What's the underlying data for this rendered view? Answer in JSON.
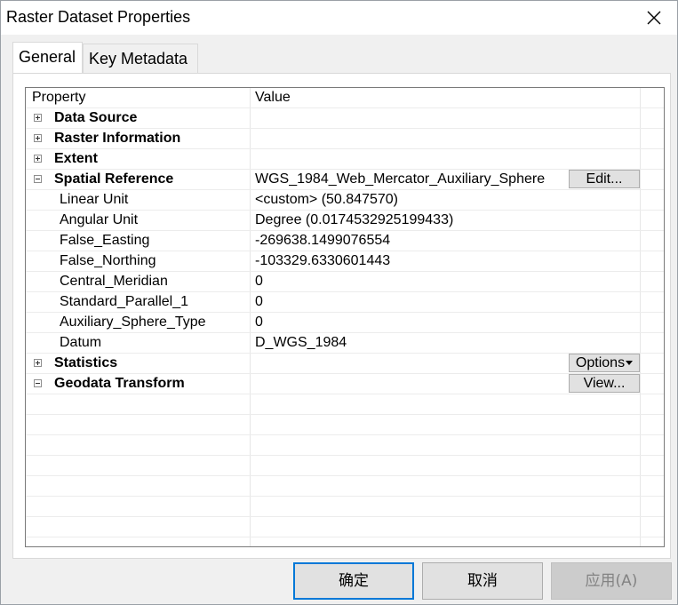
{
  "window": {
    "title": "Raster Dataset Properties"
  },
  "tabs": [
    {
      "label": "General",
      "active": true
    },
    {
      "label": "Key Metadata",
      "active": false
    }
  ],
  "grid": {
    "header": {
      "property": "Property",
      "value": "Value"
    },
    "rows": [
      {
        "kind": "group",
        "expanded": false,
        "property": "Data Source",
        "value": ""
      },
      {
        "kind": "group",
        "expanded": false,
        "property": "Raster Information",
        "value": ""
      },
      {
        "kind": "group",
        "expanded": false,
        "property": "Extent",
        "value": ""
      },
      {
        "kind": "group",
        "expanded": true,
        "property": "Spatial Reference",
        "value": "WGS_1984_Web_Mercator_Auxiliary_Sphere",
        "button": "Edit..."
      },
      {
        "kind": "child",
        "property": "Linear Unit",
        "value": "<custom> (50.847570)"
      },
      {
        "kind": "child",
        "property": "Angular Unit",
        "value": "Degree (0.0174532925199433)"
      },
      {
        "kind": "child",
        "property": "False_Easting",
        "value": "-269638.1499076554"
      },
      {
        "kind": "child",
        "property": "False_Northing",
        "value": "-103329.6330601443"
      },
      {
        "kind": "child",
        "property": "Central_Meridian",
        "value": "0"
      },
      {
        "kind": "child",
        "property": "Standard_Parallel_1",
        "value": "0"
      },
      {
        "kind": "child",
        "property": "Auxiliary_Sphere_Type",
        "value": "0"
      },
      {
        "kind": "child",
        "property": "Datum",
        "value": "D_WGS_1984"
      },
      {
        "kind": "group",
        "expanded": false,
        "property": "Statistics",
        "value": "",
        "button": "Options"
      },
      {
        "kind": "group",
        "expanded": true,
        "property": "Geodata Transform",
        "value": "",
        "button": "View..."
      }
    ]
  },
  "footer": {
    "ok_label": "确定",
    "cancel_label": "取消",
    "apply_label": "应用(A)"
  }
}
